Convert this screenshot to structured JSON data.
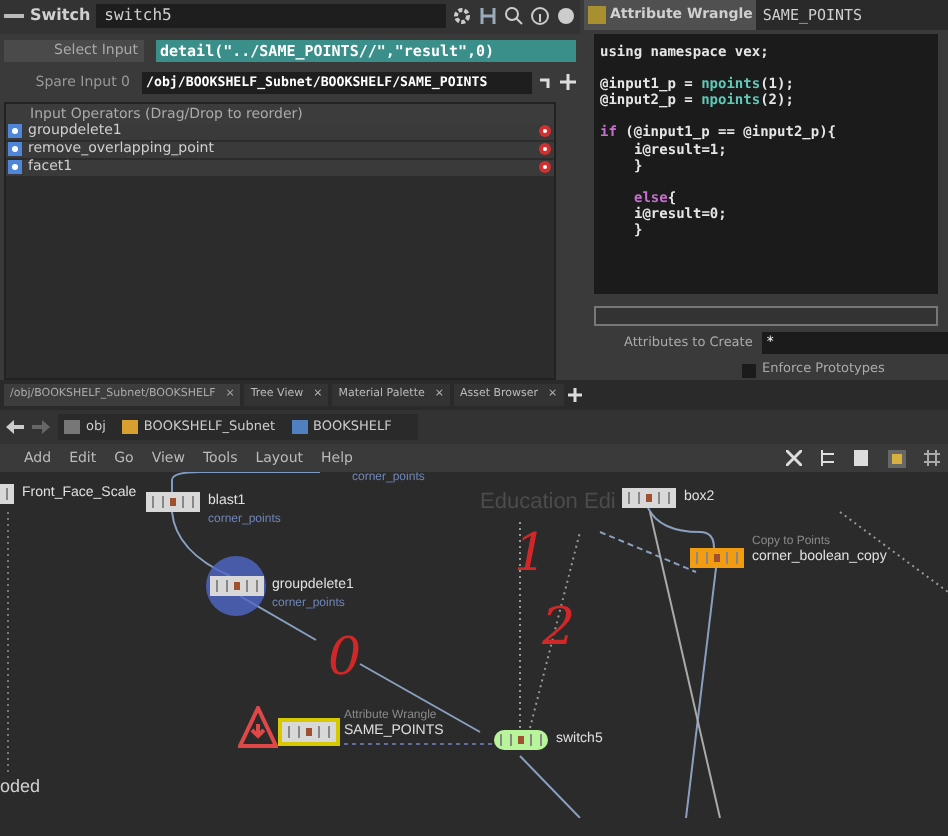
{
  "parameters": {
    "node_type": "Switch",
    "node_name": "switch5",
    "select_input_label": "Select Input",
    "select_input_value": "detail(\"../SAME_POINTS//\",\"result\",0)",
    "spare_input_label": "Spare Input 0",
    "spare_input_value": "/obj/BOOKSHELF_Subnet/BOOKSHELF/SAME_POINTS",
    "operators_header": "Input Operators (Drag/Drop to reorder)",
    "operators": [
      "groupdelete1",
      "remove_overlapping_point",
      "facet1"
    ]
  },
  "wrangle": {
    "node_type": "Attribute Wrangle",
    "node_name": "SAME_POINTS",
    "code_blocks": [
      [
        [
          {
            "t": "using namespace vex;",
            "kind": "plain"
          }
        ]
      ],
      [
        [
          {
            "t": "@input1_p = ",
            "kind": "plain"
          },
          {
            "t": "npoints",
            "kind": "func"
          },
          {
            "t": "(1);",
            "kind": "plain"
          }
        ],
        [
          {
            "t": "@input2_p = ",
            "kind": "plain"
          },
          {
            "t": "npoints",
            "kind": "func"
          },
          {
            "t": "(2);",
            "kind": "plain"
          }
        ]
      ],
      [
        [
          {
            "t": "if",
            "kind": "keyword"
          },
          {
            "t": " (@input1_p == @input2_p){",
            "kind": "plain"
          }
        ],
        [
          {
            "t": "i@result=1;",
            "kind": "plain",
            "indented": true
          }
        ],
        [
          {
            "t": "}",
            "kind": "plain",
            "indented": true
          }
        ]
      ],
      [
        [
          {
            "t": "else",
            "kind": "keyword",
            "indented": true
          },
          {
            "t": "{",
            "kind": "plain"
          }
        ],
        [
          {
            "t": "i@result=0;",
            "kind": "plain",
            "indented": true
          }
        ],
        [
          {
            "t": "}",
            "kind": "plain",
            "indented": true
          }
        ]
      ]
    ],
    "attributes_label": "Attributes to Create",
    "attributes_value": "*",
    "enforce_label": "Enforce Prototypes",
    "enforce_checked": false
  },
  "tabs": [
    {
      "label": "/obj/BOOKSHELF_Subnet/BOOKSHELF",
      "close": "×",
      "selected": true
    },
    {
      "label": "Tree View",
      "close": "×",
      "selected": false
    },
    {
      "label": "Material Palette",
      "close": "×",
      "selected": false
    },
    {
      "label": "Asset Browser",
      "close": "×",
      "selected": false
    }
  ],
  "path": [
    "obj",
    "BOOKSHELF_Subnet",
    "BOOKSHELF"
  ],
  "menu": [
    "Add",
    "Edit",
    "Go",
    "View",
    "Tools",
    "Layout",
    "Help"
  ],
  "network": {
    "watermark": "Education Edi",
    "nodes": [
      {
        "name": "Front_Face_Scale",
        "kind": "plain"
      },
      {
        "name": "blast1",
        "kind": "plain",
        "note": "corner_points"
      },
      {
        "name": "groupdelete1",
        "kind": "selected",
        "note": "corner_points"
      },
      {
        "name": "SAME_POINTS",
        "kind": "warning",
        "type": "Attribute Wrangle"
      },
      {
        "name": "box2",
        "kind": "plain"
      },
      {
        "name": "corner_boolean_copy",
        "kind": "orange",
        "type": "Copy to Points"
      },
      {
        "name": "switch5",
        "kind": "green"
      },
      {
        "name": "oded",
        "kind": "label"
      }
    ],
    "wire_notes": [
      "corner_points"
    ],
    "marks": [
      "1",
      "2",
      "0"
    ]
  }
}
